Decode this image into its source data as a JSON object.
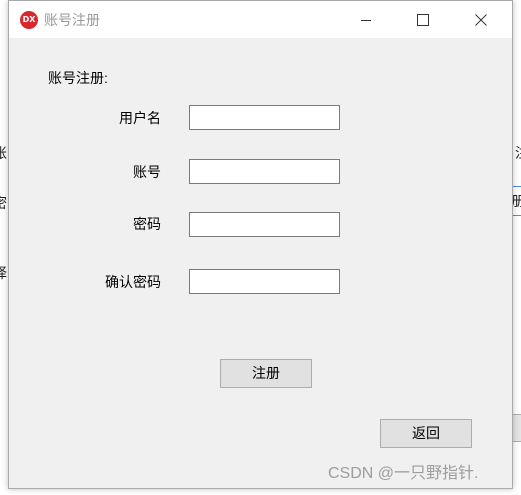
{
  "window": {
    "title": "账号注册",
    "icon_label": "DX",
    "icon_color": "#d7282e"
  },
  "form": {
    "section_label": "账号注册:",
    "fields": [
      {
        "label": "用户名",
        "value": ""
      },
      {
        "label": "账号",
        "value": ""
      },
      {
        "label": "密码",
        "value": ""
      },
      {
        "label": "确认密码",
        "value": ""
      }
    ],
    "register_label": "注册",
    "back_label": "返回"
  },
  "background": {
    "left_fragments": [
      "账",
      "密",
      "译"
    ],
    "right_fragments": [
      "注",
      "册"
    ]
  },
  "watermark": "CSDN @一只野指针."
}
